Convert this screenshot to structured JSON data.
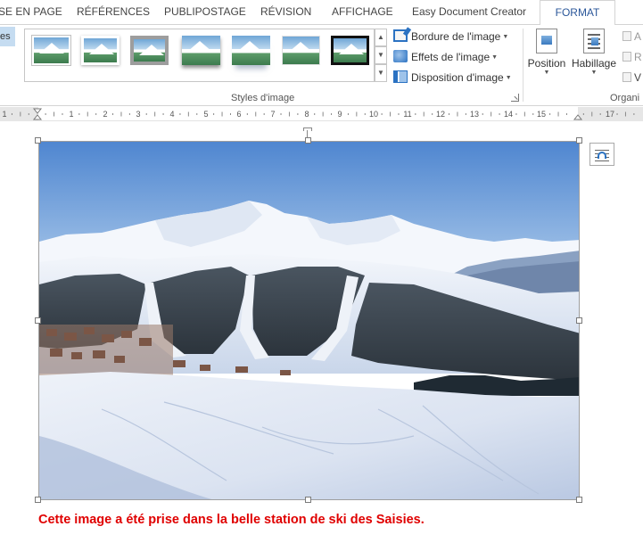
{
  "tabs": [
    {
      "label": "SE EN PAGE"
    },
    {
      "label": "RÉFÉRENCES"
    },
    {
      "label": "PUBLIPOSTAGE"
    },
    {
      "label": "RÉVISION"
    },
    {
      "label": "AFFICHAGE"
    },
    {
      "label": "Easy Document Creator"
    },
    {
      "label": "FORMAT",
      "active": true
    }
  ],
  "ribbon": {
    "left_stub_label": "es",
    "styles_group_label": "Styles d'image",
    "picture_border_label": "Bordure de l'image",
    "picture_effects_label": "Effets de l'image",
    "picture_layout_label": "Disposition d'image",
    "position_label": "Position",
    "wrap_label": "Habillage",
    "arrange_group_label": "Organi",
    "small_cmds": [
      "A",
      "R",
      "V"
    ]
  },
  "ruler": {
    "labels": [
      "1",
      "1",
      "2",
      "3",
      "4",
      "5",
      "6",
      "7",
      "8",
      "9",
      "10",
      "11",
      "12",
      "13",
      "14",
      "15",
      "17"
    ]
  },
  "document": {
    "caption": "Cette image a été prise dans la belle station de ski des Saisies."
  },
  "colors": {
    "accent": "#2b579a",
    "caption": "#e00000",
    "selected_stub": "#c5dcf1"
  }
}
